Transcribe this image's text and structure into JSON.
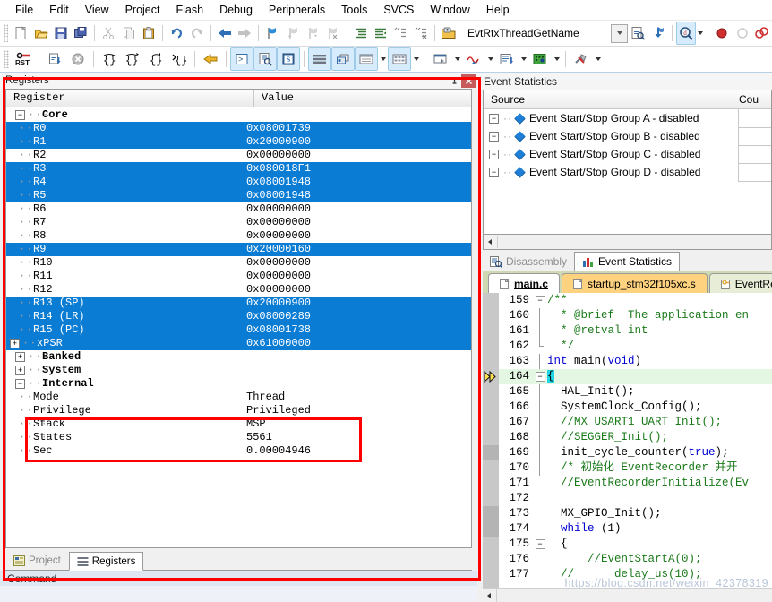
{
  "menu": {
    "items": [
      "File",
      "Edit",
      "View",
      "Project",
      "Flash",
      "Debug",
      "Peripherals",
      "Tools",
      "SVCS",
      "Window",
      "Help"
    ]
  },
  "toolbar_main": {
    "icons": [
      "new-file-icon",
      "open-folder-icon",
      "save-icon",
      "save-all-icon",
      "cut-icon",
      "copy-icon",
      "paste-icon",
      "undo-icon",
      "redo-icon",
      "back-icon",
      "forward-icon",
      "bookmark-toggle-icon",
      "bookmark-prev-icon",
      "bookmark-next-icon",
      "bookmark-clear-icon",
      "indent-icon",
      "outdent-icon",
      "comment-icon",
      "uncomment-icon",
      "open-project-icon"
    ],
    "combo_value": "EvtRtxThreadGetName",
    "after_combo_icons": [
      "find-in-files-icon",
      "bookmark-jump-icon",
      "magnify-dropdown-icon",
      "record-icon",
      "stop-circle-icon",
      "link-icon"
    ]
  },
  "toolbar_debug": {
    "icons": [
      "reset-icon",
      "run-to-main-icon",
      "stop-icon",
      "step-into-icon",
      "step-over-icon",
      "step-out-icon",
      "run-to-cursor-icon",
      "next-statement-icon",
      "command-window-icon",
      "disassembly-icon",
      "symbols-icon",
      "registers-icon",
      "call-stack-icon",
      "watch-window-icon",
      "memory-window-icon",
      "serial-window-icon",
      "analysis-icon",
      "trace-icon",
      "system-viewer-icon",
      "toolbox-icon"
    ]
  },
  "registers_panel": {
    "title": "Registers",
    "pin_icon": "pin-icon",
    "close_icon": "close-icon",
    "columns": [
      "Register",
      "Value"
    ],
    "groups": [
      {
        "name": "Core",
        "expanded": true,
        "rows": [
          {
            "name": "R0",
            "value": "0x08001739",
            "selected": true
          },
          {
            "name": "R1",
            "value": "0x20000900",
            "selected": true
          },
          {
            "name": "R2",
            "value": "0x00000000",
            "selected": false
          },
          {
            "name": "R3",
            "value": "0x080018F1",
            "selected": true
          },
          {
            "name": "R4",
            "value": "0x08001948",
            "selected": true
          },
          {
            "name": "R5",
            "value": "0x08001948",
            "selected": true
          },
          {
            "name": "R6",
            "value": "0x00000000",
            "selected": false
          },
          {
            "name": "R7",
            "value": "0x00000000",
            "selected": false
          },
          {
            "name": "R8",
            "value": "0x00000000",
            "selected": false
          },
          {
            "name": "R9",
            "value": "0x20000160",
            "selected": true
          },
          {
            "name": "R10",
            "value": "0x00000000",
            "selected": false
          },
          {
            "name": "R11",
            "value": "0x00000000",
            "selected": false
          },
          {
            "name": "R12",
            "value": "0x00000000",
            "selected": false
          },
          {
            "name": "R13 (SP)",
            "value": "0x20000900",
            "selected": true
          },
          {
            "name": "R14 (LR)",
            "value": "0x08000289",
            "selected": true
          },
          {
            "name": "R15 (PC)",
            "value": "0x08001738",
            "selected": true
          },
          {
            "name": "xPSR",
            "value": "0x61000000",
            "selected": true,
            "expandable": true
          }
        ]
      },
      {
        "name": "Banked",
        "expanded": false,
        "rows": []
      },
      {
        "name": "System",
        "expanded": false,
        "rows": []
      },
      {
        "name": "Internal",
        "expanded": true,
        "rows": [
          {
            "name": "Mode",
            "value": "Thread",
            "selected": false
          },
          {
            "name": "Privilege",
            "value": "Privileged",
            "selected": false
          },
          {
            "name": "Stack",
            "value": "MSP",
            "selected": false
          },
          {
            "name": "States",
            "value": "5561",
            "selected": false
          },
          {
            "name": "Sec",
            "value": "0.00004946",
            "selected": false
          }
        ]
      }
    ]
  },
  "bottom_tabs": {
    "items": [
      {
        "label": "Project",
        "icon": "project-icon",
        "active": false
      },
      {
        "label": "Registers",
        "icon": "registers-icon",
        "active": true
      }
    ]
  },
  "event_statistics": {
    "title": "Event Statistics",
    "columns": [
      "Source",
      "Cou"
    ],
    "rows": [
      {
        "label": "Event Start/Stop Group A - disabled",
        "count": ""
      },
      {
        "label": "Event Start/Stop Group B - disabled",
        "count": ""
      },
      {
        "label": "Event Start/Stop Group C - disabled",
        "count": ""
      },
      {
        "label": "Event Start/Stop Group D - disabled",
        "count": ""
      }
    ]
  },
  "view_tabs": {
    "items": [
      {
        "label": "Disassembly",
        "icon": "disassembly-icon",
        "active": false
      },
      {
        "label": "Event Statistics",
        "icon": "bar-chart-icon",
        "active": true
      }
    ]
  },
  "file_tabs": {
    "items": [
      {
        "label": "main.c",
        "icon": "c-file-icon",
        "state": "active"
      },
      {
        "label": "startup_stm32f105xc.s",
        "icon": "asm-file-icon",
        "state": "modified"
      },
      {
        "label": "EventRe",
        "icon": "key-file-icon",
        "state": "plain"
      }
    ]
  },
  "editor": {
    "current_line": 164,
    "lines": [
      {
        "n": "159",
        "fold": "-",
        "text": "/**",
        "cls": "cm"
      },
      {
        "n": "160",
        "fold": "",
        "text": "  * @brief  The application en",
        "cls": "cm"
      },
      {
        "n": "161",
        "fold": "",
        "text": "  * @retval int",
        "cls": "cm"
      },
      {
        "n": "162",
        "fold": "L",
        "text": "  */",
        "cls": "cm"
      },
      {
        "n": "163",
        "fold": "",
        "text": "int main(void)",
        "cls": "kwline"
      },
      {
        "n": "164",
        "fold": "-",
        "text": "{",
        "cls": "cur"
      },
      {
        "n": "165",
        "fold": "",
        "text": "  HAL_Init();",
        "cls": ""
      },
      {
        "n": "166",
        "fold": "",
        "text": "  SystemClock_Config();",
        "cls": ""
      },
      {
        "n": "167",
        "fold": "",
        "text": "  //MX_USART1_UART_Init();",
        "cls": "cm"
      },
      {
        "n": "168",
        "fold": "",
        "text": "  //SEGGER_Init();",
        "cls": "cm"
      },
      {
        "n": "169",
        "fold": "",
        "text": "  init_cycle_counter(true);",
        "cls": "kwline"
      },
      {
        "n": "170",
        "fold": "",
        "text": "  /* 初始化 EventRecorder 并开",
        "cls": "cm"
      },
      {
        "n": "171",
        "fold": "",
        "text": "  //EventRecorderInitialize(Ev",
        "cls": "cm"
      },
      {
        "n": "172",
        "fold": "",
        "text": "",
        "cls": ""
      },
      {
        "n": "173",
        "fold": "",
        "text": "  MX_GPIO_Init();",
        "cls": ""
      },
      {
        "n": "174",
        "fold": "",
        "text": "  while (1)",
        "cls": "kwline"
      },
      {
        "n": "175",
        "fold": "-",
        "text": "  {",
        "cls": ""
      },
      {
        "n": "176",
        "fold": "",
        "text": "      //EventStartA(0);",
        "cls": "cm"
      },
      {
        "n": "177",
        "fold": "",
        "text": "  //      delay_us(10);",
        "cls": "cm"
      }
    ]
  },
  "command_pane": {
    "title": "Command"
  },
  "watermark": {
    "text": "https://blog.csdn.net/weixin_42378319"
  },
  "colors": {
    "selection_blue": "#0b7cd4",
    "annotation_red": "#ff0000",
    "current_line_green": "#e3f7e3",
    "modified_tab": "#ffd27f"
  }
}
